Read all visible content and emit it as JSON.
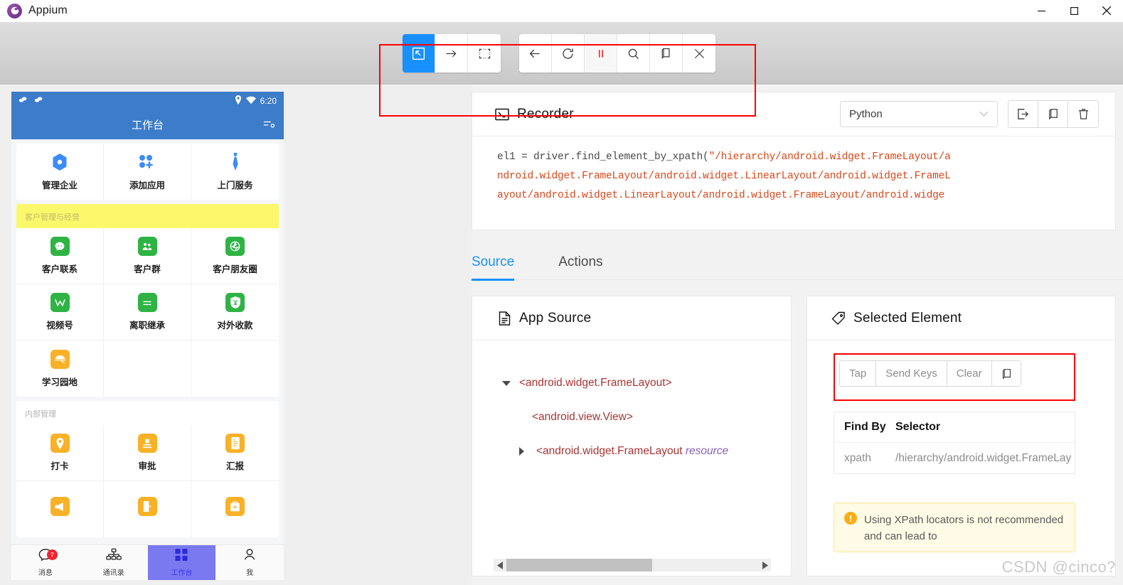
{
  "window": {
    "title": "Appium",
    "logo_icon": "appium-logo-icon",
    "minimize_label": "—",
    "maximize_label": "☐",
    "close_label": "✕"
  },
  "toolbar": {
    "group1": [
      {
        "name": "select-element-icon",
        "label": "Select Element",
        "active": true
      },
      {
        "name": "swipe-by-coordinates-icon",
        "label": "Swipe By Coordinates",
        "active": false
      },
      {
        "name": "tap-by-coordinates-icon",
        "label": "Tap By Coordinates",
        "active": false
      }
    ],
    "group2": [
      {
        "name": "back-icon",
        "label": "Back"
      },
      {
        "name": "refresh-icon",
        "label": "Refresh Source"
      },
      {
        "name": "pause-recording-icon",
        "label": "Pause Recording"
      },
      {
        "name": "search-for-element-icon",
        "label": "Search for Element"
      },
      {
        "name": "copy-xml-icon",
        "label": "Copy XML"
      },
      {
        "name": "quit-session-icon",
        "label": "Quit Session"
      }
    ]
  },
  "phone": {
    "status_bar": {
      "time": "6:20",
      "left_icons": [
        "sync-icon",
        "sync-icon"
      ],
      "right_icons": [
        "location-icon",
        "wifi-icon"
      ]
    },
    "header": {
      "title": "工作台",
      "action_icon": "filter-settings-icon"
    },
    "top_card": [
      {
        "label": "管理企业",
        "icon": "hexagon-icon"
      },
      {
        "label": "添加应用",
        "icon": "add-app-icon"
      },
      {
        "label": "上门服务",
        "icon": "tie-icon"
      }
    ],
    "sections": [
      {
        "title": "客户管理与经营",
        "highlight": true,
        "items": [
          {
            "label": "客户联系",
            "icon": "chat-icon",
            "color": "green"
          },
          {
            "label": "客户群",
            "icon": "group-icon",
            "color": "green"
          },
          {
            "label": "客户朋友圈",
            "icon": "moments-icon",
            "color": "green"
          },
          {
            "label": "视频号",
            "icon": "channels-icon",
            "color": "green"
          },
          {
            "label": "离职继承",
            "icon": "transfer-icon",
            "color": "green"
          },
          {
            "label": "对外收款",
            "icon": "payment-icon",
            "color": "green"
          },
          {
            "label": "学习园地",
            "icon": "study-icon",
            "color": "orange"
          },
          {
            "label": "",
            "icon": "",
            "color": ""
          },
          {
            "label": "",
            "icon": "",
            "color": ""
          }
        ]
      },
      {
        "title": "内部管理",
        "highlight": false,
        "items": [
          {
            "label": "打卡",
            "icon": "location-pin-icon",
            "color": "orange"
          },
          {
            "label": "审批",
            "icon": "approval-icon",
            "color": "orange"
          },
          {
            "label": "汇报",
            "icon": "report-icon",
            "color": "orange"
          },
          {
            "label": "",
            "icon": "announce-icon",
            "color": "orange"
          },
          {
            "label": "",
            "icon": "door-icon",
            "color": "orange"
          },
          {
            "label": "",
            "icon": "medkit-icon",
            "color": "orange"
          }
        ]
      }
    ],
    "tabbar": [
      {
        "label": "消息",
        "icon": "message-icon",
        "badge": "7",
        "selected": false
      },
      {
        "label": "通讯录",
        "icon": "contacts-icon",
        "badge": "",
        "selected": false
      },
      {
        "label": "工作台",
        "icon": "workbench-icon",
        "badge": "",
        "selected": true
      },
      {
        "label": "我",
        "icon": "profile-icon",
        "badge": "",
        "selected": false
      }
    ]
  },
  "recorder": {
    "title": "Recorder",
    "title_icon": "terminal-icon",
    "language": "Python",
    "language_caret_icon": "chevron-down-icon",
    "actions": [
      {
        "name": "show-code-boilerplate-icon",
        "label": "Show Code Boilerplate"
      },
      {
        "name": "copy-code-icon",
        "label": "Copy Code"
      },
      {
        "name": "clear-actions-icon",
        "label": "Clear Actions"
      }
    ],
    "code_prefix": "el1 = driver.find_element_by_xpath(",
    "code_lines": [
      "\"/hierarchy/android.widget.FrameLayout/a",
      "ndroid.widget.FrameLayout/android.widget.LinearLayout/android.widget.FrameL",
      "ayout/android.widget.LinearLayout/android.widget.FrameLayout/android.widge"
    ]
  },
  "tabs": [
    {
      "label": "Source",
      "active": true
    },
    {
      "label": "Actions",
      "active": false
    }
  ],
  "app_source": {
    "title": "App Source",
    "title_icon": "file-icon",
    "nodes": [
      {
        "caret": "down",
        "indent": 0,
        "text": "<android.widget.FrameLayout>",
        "resource": ""
      },
      {
        "caret": "none",
        "indent": 1,
        "text": "<android.view.View>",
        "resource": ""
      },
      {
        "caret": "right",
        "indent": 0,
        "text": "<android.widget.FrameLayout ",
        "resource": "resource"
      }
    ],
    "scrollbar": {
      "left_arrow_icon": "chevron-left-icon",
      "right_arrow_icon": "chevron-right-icon"
    }
  },
  "selected_element": {
    "title": "Selected Element",
    "title_icon": "tag-icon",
    "actions": [
      {
        "label": "Tap",
        "name": "tap-button"
      },
      {
        "label": "Send Keys",
        "name": "send-keys-button"
      },
      {
        "label": "Clear",
        "name": "clear-button"
      },
      {
        "label": "",
        "name": "copy-attributes-icon"
      }
    ],
    "table": {
      "headers": [
        "Find By",
        "Selector"
      ],
      "rows": [
        {
          "find_by": "xpath",
          "selector": "/hierarchy/android.widget.FrameLay"
        }
      ]
    },
    "warning": {
      "icon": "warning-icon",
      "text": "Using XPath locators is not recommended and can lead to"
    }
  },
  "watermark": "CSDN @cinco?"
}
